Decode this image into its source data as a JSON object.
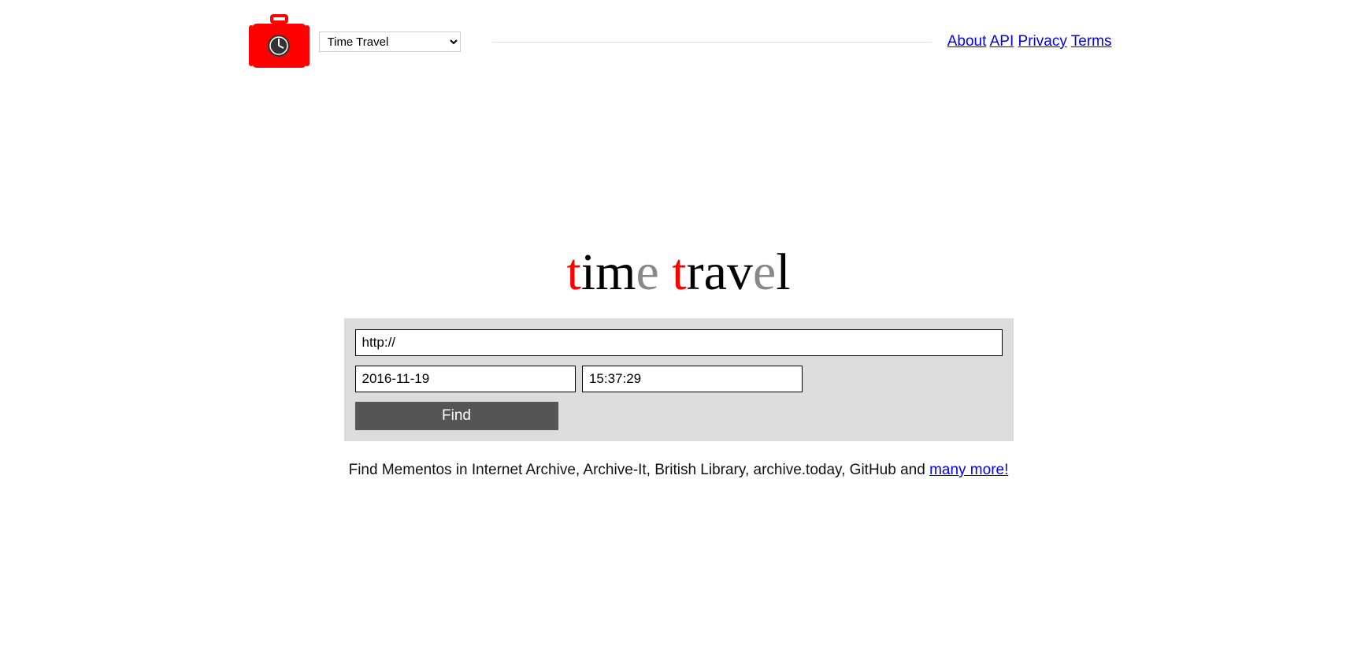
{
  "header": {
    "nav_select_value": "Time Travel",
    "links": {
      "about": "About",
      "api": "API",
      "privacy": "Privacy",
      "terms": "Terms"
    }
  },
  "title": {
    "t1": "t",
    "ime": "im",
    "e1": "e",
    "sp": " ",
    "t2": "t",
    "rav": "rav",
    "e2": "e",
    "l": "l"
  },
  "form": {
    "url_value": "http://",
    "date_value": "2016-11-19",
    "time_value": "15:37:29",
    "find_label": "Find"
  },
  "tagline": {
    "text": "Find Mementos in Internet Archive, Archive-It, British Library, archive.today, GitHub and ",
    "link": "many more!"
  }
}
